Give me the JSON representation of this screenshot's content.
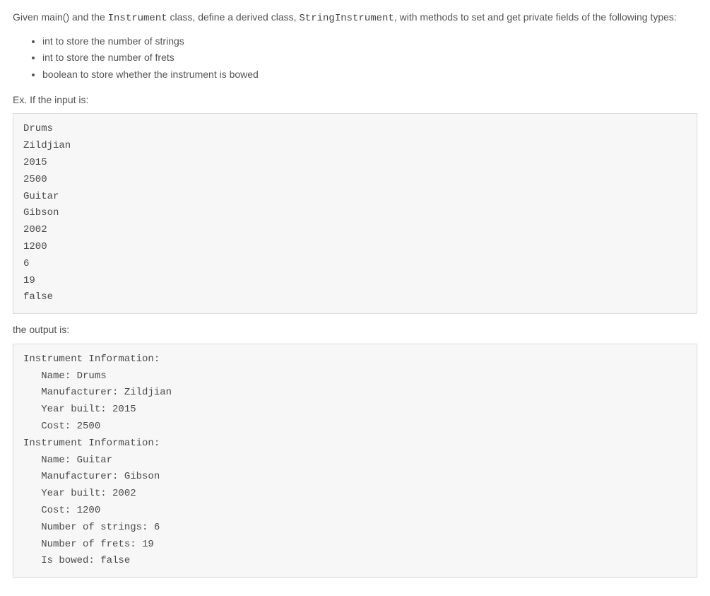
{
  "intro": {
    "prefix": "Given main() and the ",
    "code1": "Instrument",
    "mid1": " class, define a derived class, ",
    "code2": "StringInstrument",
    "suffix": ", with methods to set and get private fields of the following types:"
  },
  "requirements": [
    "int to store the number of strings",
    "int to store the number of frets",
    "boolean to store whether the instrument is bowed"
  ],
  "example_label": "Ex. If the input is:",
  "input_block": "Drums\nZildjian\n2015\n2500\nGuitar\nGibson\n2002\n1200\n6\n19\nfalse",
  "output_label": "the output is:",
  "output_block": "Instrument Information:\n   Name: Drums\n   Manufacturer: Zildjian\n   Year built: 2015\n   Cost: 2500\nInstrument Information:\n   Name: Guitar\n   Manufacturer: Gibson\n   Year built: 2002\n   Cost: 1200\n   Number of strings: 6\n   Number of frets: 19\n   Is bowed: false"
}
